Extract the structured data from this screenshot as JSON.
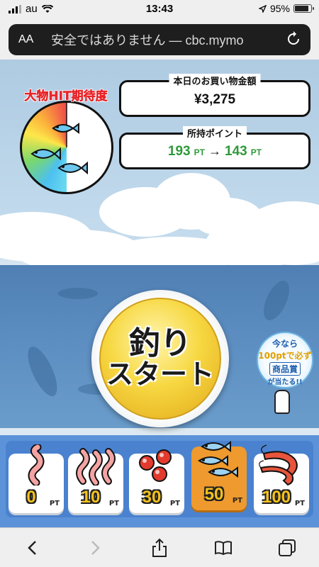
{
  "status_bar": {
    "carrier": "au",
    "time": "13:43",
    "battery_percent": "95%",
    "battery_level": 0.95,
    "icons": [
      "signal-icon",
      "wifi-icon",
      "location-arrow-icon",
      "battery-icon"
    ]
  },
  "browser": {
    "aa_label": "AA",
    "url_text": "安全ではありません — cbc.mymo",
    "reload_icon": "reload-icon"
  },
  "game": {
    "gauge_label": "大物HIT期待度",
    "purchase": {
      "title": "本日のお買い物金額",
      "amount": "¥3,275"
    },
    "points": {
      "title": "所持ポイント",
      "from_value": "193",
      "from_unit": "PT",
      "arrow": "→",
      "to_value": "143",
      "to_unit": "PT"
    },
    "start_button": {
      "line1": "釣り",
      "line2": "スタート"
    },
    "promo": {
      "line1": "今なら",
      "line2": "100ptで必ず",
      "line3": "商品賞",
      "line4": "が当たる!!"
    },
    "baits": [
      {
        "value": "0",
        "unit": "PT",
        "icon": "worm-icon",
        "selected": false
      },
      {
        "value": "10",
        "unit": "PT",
        "icon": "worms-icon",
        "selected": false
      },
      {
        "value": "30",
        "unit": "PT",
        "icon": "red-berries-icon",
        "selected": false
      },
      {
        "value": "50",
        "unit": "PT",
        "icon": "sardines-icon",
        "selected": true
      },
      {
        "value": "100",
        "unit": "PT",
        "icon": "shrimp-icon",
        "selected": false
      }
    ]
  },
  "toolbar": {
    "icons": [
      "back-icon",
      "forward-icon",
      "share-icon",
      "bookmarks-icon",
      "tabs-icon"
    ]
  },
  "colors": {
    "selected_bait": "#ee9a2e",
    "points_green": "#2f9a3a",
    "gauge_label_red": "#e8262a",
    "tray_blue": "#5c92d8"
  }
}
